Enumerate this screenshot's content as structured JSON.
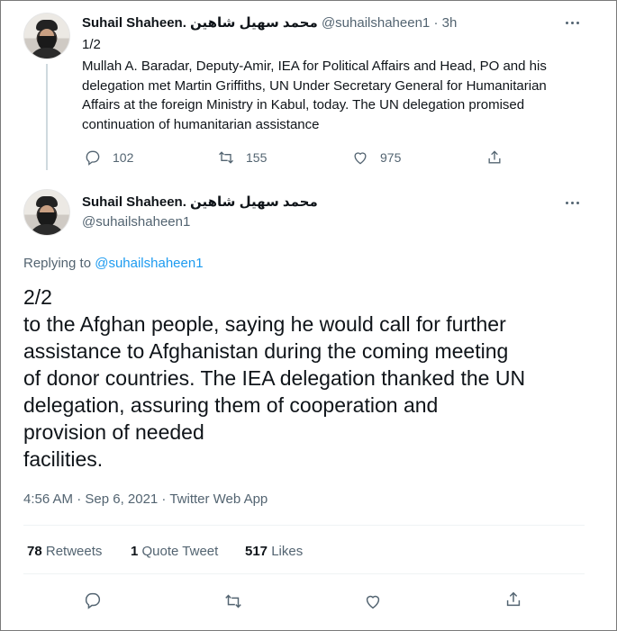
{
  "tweet1": {
    "name": "Suhail Shaheen. محمد سهيل شاهين",
    "handle": "@suhailshaheen1",
    "time": "· 3h",
    "index": "1/2",
    "text": "Mullah A. Baradar, Deputy-Amir, IEA for Political Affairs and Head, PO and his delegation met Martin Griffiths, UN Under Secretary General for Humanitarian Affairs at the foreign Ministry  in Kabul, today. The UN delegation promised continuation of humanitarian assistance",
    "replies": "102",
    "retweets": "155",
    "likes": "975",
    "icons": [
      "reply-icon",
      "retweet-icon",
      "like-icon",
      "share-icon"
    ]
  },
  "tweet2": {
    "name": "Suhail Shaheen. محمد سهيل شاهين",
    "handle": "@suhailshaheen1",
    "replying_prefix": "Replying to ",
    "replying_to": "@suhailshaheen1",
    "text": "2/2\nto the Afghan people, saying he would call for further\nassistance to Afghanistan during the coming meeting\nof donor countries. The IEA delegation thanked the UN\ndelegation, assuring them of cooperation and\nprovision of needed\nfacilities.",
    "timestamp": "4:56 AM · Sep 6, 2021 · Twitter Web App",
    "stats": {
      "retweets_count": "78",
      "retweets_label": "Retweets",
      "quotes_count": "1",
      "quotes_label": "Quote Tweet",
      "likes_count": "517",
      "likes_label": "Likes"
    }
  },
  "colors": {
    "accent": "#1d9bf0",
    "muted": "#536471",
    "text": "#0f1419",
    "divider": "#eff3f4"
  }
}
